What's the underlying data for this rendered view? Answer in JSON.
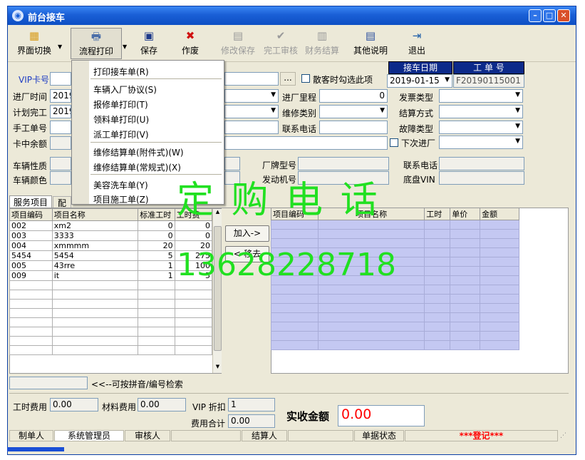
{
  "window": {
    "title": "前台接车"
  },
  "toolbar": {
    "switch_label": "界面切换",
    "print_label": "流程打印",
    "save_label": "保存",
    "void_label": "作废",
    "modify_save_label": "修改保存",
    "complete_label": "完工审核",
    "settle_label": "财务结算",
    "other_label": "其他说明",
    "exit_label": "退出"
  },
  "menu": {
    "items": [
      "打印接车单(R)",
      "车辆入厂协议(S)",
      "报修单打印(T)",
      "领料单打印(U)",
      "派工单打印(V)",
      "维修结算单(附件式)(W)",
      "维修结算单(常规式)(X)",
      "美容洗车单(Y)",
      "项目施工单(Z)"
    ]
  },
  "form": {
    "vip_label": "VIP卡号",
    "in_time_label": "进厂时间",
    "in_time_value": "2019",
    "plan_done_label": "计划完工",
    "plan_done_value": "2019",
    "manual_no_label": "手工单号",
    "card_balance_label": "卡中余额",
    "ellipsis": "...",
    "walkin_label": "散客时勾选此项",
    "receive_date_label": "接车日期",
    "receive_date_value": "2019-01-15",
    "work_no_label": "工 单 号",
    "work_no_value": "F20190115001",
    "mileage_label": "进厂里程",
    "mileage_value": "0",
    "repair_type_label": "维修类别",
    "contact_phone_label": "联系电话",
    "invoice_type_label": "发票类型",
    "settle_method_label": "结算方式",
    "fault_type_label": "故障类型",
    "next_entry_label": "下次进厂",
    "vehicle_nature_label": "车辆性质",
    "vehicle_color_label": "车辆颜色",
    "brand_model_label": "厂牌型号",
    "engine_no_label": "发动机号",
    "contact_phone2_label": "联系电话",
    "vin_label": "底盘VIN"
  },
  "tabs": {
    "service": "服务项目",
    "parts": "配"
  },
  "left_table": {
    "headers": [
      "项目编码",
      "项目名称",
      "标准工时",
      "工时费"
    ],
    "rows": [
      [
        "002",
        "xm2",
        "0",
        "0"
      ],
      [
        "003",
        "3333",
        "0",
        "0"
      ],
      [
        "004",
        "xmmmm",
        "20",
        "20"
      ],
      [
        "5454",
        "5454",
        "5",
        "275"
      ],
      [
        "005",
        "43rre",
        "1",
        "100"
      ],
      [
        "009",
        "it",
        "1",
        "5"
      ]
    ]
  },
  "right_table": {
    "headers": [
      "项目编码",
      "项目名称",
      "工时",
      "单价",
      "金额"
    ]
  },
  "buttons": {
    "add": "加入->",
    "remove": "<-移去"
  },
  "search_hint": "<<--可按拼音/编号检索",
  "footer": {
    "labor_fee_label": "工时费用",
    "labor_fee_value": "0.00",
    "material_fee_label": "材料费用",
    "material_fee_value": "0.00",
    "vip_discount_label": "VIP 折扣",
    "vip_discount_value": "1",
    "fee_total_label": "费用合计",
    "fee_total_value": "0.00",
    "actual_label": "实收金额",
    "actual_value": "0.00"
  },
  "status": {
    "maker_label": "制单人",
    "maker_value": "系统管理员",
    "auditor_label": "审核人",
    "settler_label": "结算人",
    "doc_status_label": "单据状态",
    "doc_status_value": "***登记***"
  },
  "watermark": {
    "text": "定 购 电 话",
    "phone": "13628228718"
  },
  "colors": {
    "title_blue": "#1a5fd6",
    "header_navy": "#0c2a8a",
    "grid_lilac": "#c4c8f2",
    "watermark_green": "#21e021",
    "status_red": "#ff0000"
  }
}
